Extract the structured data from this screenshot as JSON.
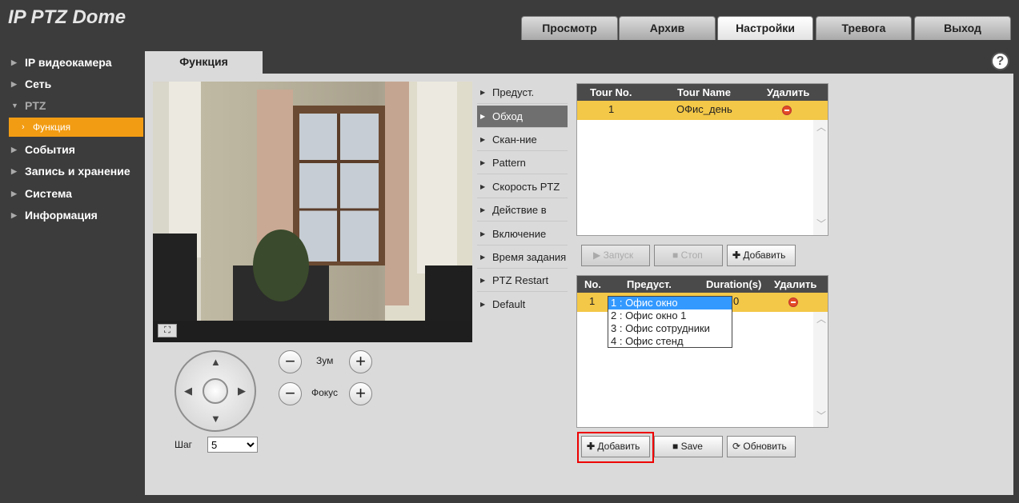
{
  "app_title": "IP PTZ Dome",
  "nav_tabs": [
    {
      "label": "Просмотр"
    },
    {
      "label": "Архив"
    },
    {
      "label": "Настройки"
    },
    {
      "label": "Тревога"
    },
    {
      "label": "Выход"
    }
  ],
  "sidebar": [
    {
      "label": "IP видеокамера"
    },
    {
      "label": "Сеть"
    },
    {
      "label": "PTZ"
    },
    {
      "label": "Функция"
    },
    {
      "label": "События"
    },
    {
      "label": "Запись и хранение"
    },
    {
      "label": "Система"
    },
    {
      "label": "Информация"
    }
  ],
  "page_tab": "Функция",
  "help": "?",
  "zoom_label": "Зум",
  "focus_label": "Фокус",
  "step_label": "Шаг",
  "step_value": "5",
  "func_menu": [
    {
      "label": "Предуст."
    },
    {
      "label": "Обход"
    },
    {
      "label": "Скан-ние"
    },
    {
      "label": "Pattern"
    },
    {
      "label": "Скорость PTZ"
    },
    {
      "label": "Действие в"
    },
    {
      "label": "Включение"
    },
    {
      "label": "Время задания"
    },
    {
      "label": "PTZ Restart"
    },
    {
      "label": "Default"
    }
  ],
  "tour_table": {
    "headers": {
      "no": "Tour No.",
      "name": "Tour Name",
      "del": "Удалить"
    },
    "rows": [
      {
        "no": "1",
        "name": "ОФис_день"
      }
    ]
  },
  "tour_buttons": {
    "start": "Запуск",
    "stop": "Стоп",
    "add": "Добавить"
  },
  "preset_table": {
    "headers": {
      "no": "No.",
      "preset": "Предуст.",
      "duration": "Duration(s)",
      "del": "Удалить"
    },
    "rows": [
      {
        "no": "1",
        "duration_tail": "0"
      }
    ]
  },
  "preset_dropdown": [
    {
      "label": "1 : Офис окно"
    },
    {
      "label": "2 : Офис окно 1"
    },
    {
      "label": "3 : Офис сотрудники"
    },
    {
      "label": "4 : Офис стенд"
    }
  ],
  "bottom_buttons": {
    "add": "Добавить",
    "save": "Save",
    "refresh": "Обновить"
  }
}
